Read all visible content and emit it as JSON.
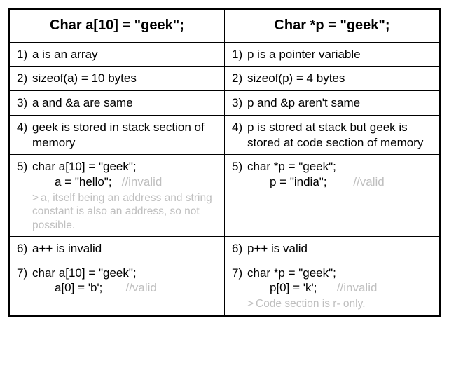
{
  "headers": {
    "left": "Char a[10] = \"geek\";",
    "right": "Char *p = \"geek\";"
  },
  "rows": [
    {
      "n": "1)",
      "left": {
        "text": "a is an array"
      },
      "right": {
        "text": "p is a pointer variable"
      }
    },
    {
      "n": "2)",
      "left": {
        "text": "sizeof(a) = 10 bytes"
      },
      "right": {
        "text": "sizeof(p) = 4 bytes"
      }
    },
    {
      "n": "3)",
      "left": {
        "text": "a and &a are same"
      },
      "right": {
        "text": "p and &p aren't same"
      }
    },
    {
      "n": "4)",
      "left": {
        "text": "geek is stored in stack section of memory"
      },
      "right": {
        "text": "p is stored at stack but geek is stored at code section of memory"
      }
    },
    {
      "n": "5)",
      "left": {
        "code1": "char a[10] = \"geek\";",
        "code2": "a = \"hello\";",
        "comment": "//invalid",
        "note": "a, itself being an address and string constant is also an address, so not possible."
      },
      "right": {
        "code1": "char *p = \"geek\";",
        "code2": "p = \"india\";",
        "comment": "//valid"
      }
    },
    {
      "n": "6)",
      "left": {
        "text": "a++ is invalid"
      },
      "right": {
        "text": "p++ is valid"
      }
    },
    {
      "n": "7)",
      "left": {
        "code1": "char a[10] = \"geek\";",
        "code2": "a[0] = 'b';",
        "comment": "//valid"
      },
      "right": {
        "code1": "char *p = \"geek\";",
        "code2": "p[0] = 'k';",
        "comment": "//invalid",
        "note": "Code section is r- only."
      }
    }
  ]
}
